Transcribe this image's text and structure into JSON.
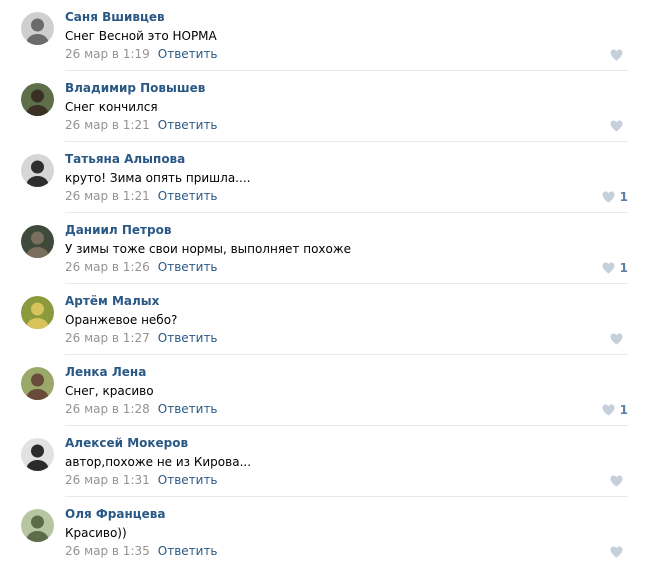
{
  "comments": [
    {
      "author": "Саня Вшивцев",
      "text": "Снег Весной это НОРМА",
      "date": "26 мар в 1:19",
      "reply": "Ответить",
      "likes": "",
      "avatar_bg": "#cfcfcf",
      "avatar_fg": "#6b6b6b"
    },
    {
      "author": "Владимир Повышев",
      "text": "Снег кончился",
      "date": "26 мар в 1:21",
      "reply": "Ответить",
      "likes": "",
      "avatar_bg": "#5e6f4a",
      "avatar_fg": "#3b3025"
    },
    {
      "author": "Татьяна Алыпова",
      "text": "круто! Зима опять пришла....",
      "date": "26 мар в 1:21",
      "reply": "Ответить",
      "likes": "1",
      "avatar_bg": "#d6d6d6",
      "avatar_fg": "#2e2e2e"
    },
    {
      "author": "Даниил Петров",
      "text": "У зимы тоже свои нормы, выполняет похоже",
      "date": "26 мар в 1:26",
      "reply": "Ответить",
      "likes": "1",
      "avatar_bg": "#3f4a3a",
      "avatar_fg": "#7a6f5e"
    },
    {
      "author": "Артём Малых",
      "text": "Оранжевое небо?",
      "date": "26 мар в 1:27",
      "reply": "Ответить",
      "likes": "",
      "avatar_bg": "#8a9a3c",
      "avatar_fg": "#d8c25a"
    },
    {
      "author": "Ленка Лена",
      "text": "Снег, красиво",
      "date": "26 мар в 1:28",
      "reply": "Ответить",
      "likes": "1",
      "avatar_bg": "#9aa86a",
      "avatar_fg": "#6a4a3a"
    },
    {
      "author": "Алексей Мокеров",
      "text": "автор,похоже не из Кирова...",
      "date": "26 мар в 1:31",
      "reply": "Ответить",
      "likes": "",
      "avatar_bg": "#e2e2e2",
      "avatar_fg": "#2b2b2b"
    },
    {
      "author": "Оля Францева",
      "text": "Красиво))",
      "date": "26 мар в 1:35",
      "reply": "Ответить",
      "likes": "",
      "avatar_bg": "#b7c6a0",
      "avatar_fg": "#5c6b4a"
    }
  ],
  "colors": {
    "author": "#2a5885",
    "date": "#939393",
    "like_icon": "#c5d0db",
    "like_count": "#5b7fa6",
    "divider": "#e7e8ec"
  },
  "icons": {
    "like": "heart-icon"
  }
}
